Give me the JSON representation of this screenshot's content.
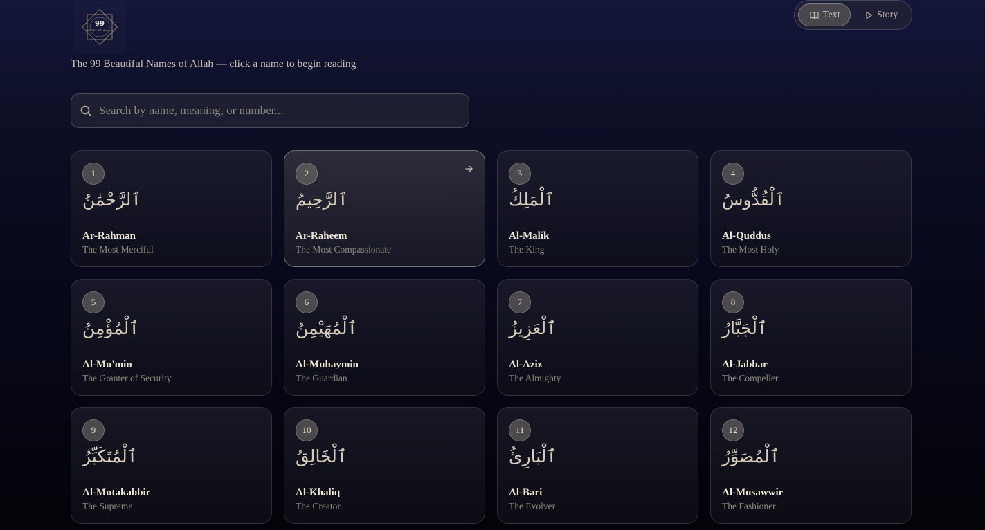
{
  "logo": {
    "text": "99",
    "subtext": "NAMES OF ALLAH"
  },
  "mode_toggle": {
    "text_label": "Text",
    "story_label": "Story"
  },
  "subtitle": "The 99 Beautiful Names of Allah — click a name to begin reading",
  "search": {
    "placeholder": "Search by name, meaning, or number..."
  },
  "names": [
    {
      "number": "1",
      "arabic": "ٱلرَّحْمَٰنُ",
      "transliteration": "Ar-Rahman",
      "meaning": "The Most Merciful"
    },
    {
      "number": "2",
      "arabic": "ٱلرَّحِيمُ",
      "transliteration": "Ar-Raheem",
      "meaning": "The Most Compassionate"
    },
    {
      "number": "3",
      "arabic": "ٱلْمَلِكُ",
      "transliteration": "Al-Malik",
      "meaning": "The King"
    },
    {
      "number": "4",
      "arabic": "ٱلْقُدُّوسُ",
      "transliteration": "Al-Quddus",
      "meaning": "The Most Holy"
    },
    {
      "number": "5",
      "arabic": "ٱلْمُؤْمِنُ",
      "transliteration": "Al-Mu'min",
      "meaning": "The Granter of Security"
    },
    {
      "number": "6",
      "arabic": "ٱلْمُهَيْمِنُ",
      "transliteration": "Al-Muhaymin",
      "meaning": "The Guardian"
    },
    {
      "number": "7",
      "arabic": "ٱلْعَزِيزُ",
      "transliteration": "Al-Aziz",
      "meaning": "The Almighty"
    },
    {
      "number": "8",
      "arabic": "ٱلْجَبَّارُ",
      "transliteration": "Al-Jabbar",
      "meaning": "The Compeller"
    },
    {
      "number": "9",
      "arabic": "ٱلْمُتَكَبِّرُ",
      "transliteration": "Al-Mutakabbir",
      "meaning": "The Supreme"
    },
    {
      "number": "10",
      "arabic": "ٱلْخَالِقُ",
      "transliteration": "Al-Khaliq",
      "meaning": "The Creator"
    },
    {
      "number": "11",
      "arabic": "ٱلْبَارِئُ",
      "transliteration": "Al-Bari",
      "meaning": "The Evolver"
    },
    {
      "number": "12",
      "arabic": "ٱلْمُصَوِّرُ",
      "transliteration": "Al-Musawwir",
      "meaning": "The Fashioner"
    }
  ]
}
